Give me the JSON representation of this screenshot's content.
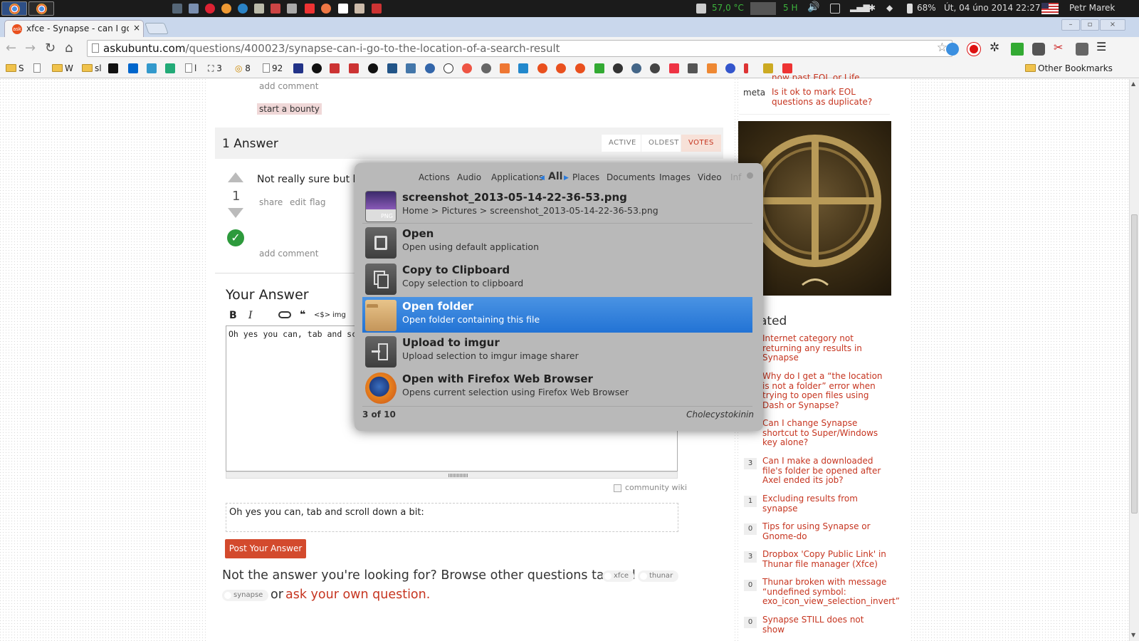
{
  "system_panel": {
    "temperature": "57,0 °C",
    "network": "5 H",
    "battery": "68%",
    "datetime": "Út, 04 úno 2014 22:27",
    "user": "Petr Marek"
  },
  "browser": {
    "tab_title": "xfce - Synapse - can I go to",
    "tab_close": "×",
    "favicon_text": "ask",
    "url_host": "askubuntu.com",
    "url_path": "/questions/400023/synapse-can-i-go-to-the-location-of-a-search-result",
    "other_bookmarks": "Other Bookmarks",
    "bookmarks": [
      {
        "label": "S",
        "icon": "folder"
      },
      {
        "label": "",
        "icon": "page"
      },
      {
        "label": "W",
        "icon": "folder"
      },
      {
        "label": "sl",
        "icon": "folder"
      },
      {
        "label": "l",
        "icon": "page"
      },
      {
        "label": "3",
        "icon": "grid"
      },
      {
        "label": "8",
        "icon": "coin"
      },
      {
        "label": "92",
        "icon": "page"
      }
    ]
  },
  "page": {
    "add_comment_1": "add comment",
    "start_bounty": "start a bounty",
    "answers_count": "1 Answer",
    "sort_tabs": [
      "ACTIVE",
      "OLDEST",
      "VOTES"
    ],
    "vote_count": "1",
    "answer_text": "Not really sure but last",
    "answer_actions": [
      "share",
      "edit",
      "flag"
    ],
    "add_comment_2": "add comment",
    "your_answer": "Your Answer",
    "editor_text": "Oh yes you can, tab and sc",
    "editor_toolbar": [
      "B",
      "I",
      "<$>",
      "img"
    ],
    "community_wiki": "community wiki",
    "preview_text": "Oh yes you can, tab and scroll down a bit:",
    "post_button": "Post Your Answer",
    "footer_prefix": "Not the answer you're looking for? Browse other questions tagged",
    "footer_tags": [
      "xfce",
      "thunar",
      "synapse"
    ],
    "footer_or": "or",
    "footer_link": "ask your own question."
  },
  "sidebar": {
    "partial_top": "now past EOL or Life",
    "meta_label": "meta",
    "meta_link": "Is it ok to mark EOL questions as duplicate?",
    "related_heading": "ated",
    "related": [
      {
        "count": "",
        "title": "Internet category not returning any results in Synapse"
      },
      {
        "count": "",
        "title": "Why do I get a “the location is not a folder” error when trying to open files using Dash or Synapse?"
      },
      {
        "count": "",
        "title": "Can I change Synapse shortcut to Super/Windows key alone?"
      },
      {
        "count": "3",
        "title": "Can I make a downloaded file's folder be opened after Axel ended its job?"
      },
      {
        "count": "1",
        "title": "Excluding results from synapse"
      },
      {
        "count": "0",
        "title": "Tips for using Synapse or Gnome-do"
      },
      {
        "count": "3",
        "title": "Dropbox 'Copy Public Link' in Thunar file manager (Xfce)"
      },
      {
        "count": "0",
        "title": "Thunar broken with message “undefined symbol: exo_icon_view_selection_invert”"
      },
      {
        "count": "0",
        "title": "Synapse STILL does not show"
      }
    ]
  },
  "synapse": {
    "categories": [
      "Actions",
      "Audio",
      "Applications",
      "All",
      "Places",
      "Documents",
      "Images",
      "Video",
      "Inf"
    ],
    "selected_category": "All",
    "file": {
      "name": "screenshot_2013-05-14-22-36-53.png",
      "path": "Home > Pictures > screenshot_2013-05-14-22-36-53.png",
      "badge": "PNG"
    },
    "actions": [
      {
        "title": "Open",
        "desc": "Open using default application",
        "icon": "open-icon"
      },
      {
        "title": "Copy to Clipboard",
        "desc": "Copy selection to clipboard",
        "icon": "clipboard-icon"
      },
      {
        "title": "Open folder",
        "desc": "Open folder containing this file",
        "icon": "folder-icon",
        "selected": true
      },
      {
        "title": "Upload to imgur",
        "desc": "Upload selection to imgur image sharer",
        "icon": "upload-icon"
      },
      {
        "title": "Open with Firefox Web Browser",
        "desc": "Opens current selection using Firefox Web Browser",
        "icon": "firefox-icon"
      }
    ],
    "counter": "3 of 10",
    "query": "Cholecystokinin"
  },
  "colors": {
    "accent_link": "#c63520",
    "selection_blue": "#2a7bdc",
    "post_button": "#d34a2d",
    "panel_bg": "#1b1b1b"
  }
}
